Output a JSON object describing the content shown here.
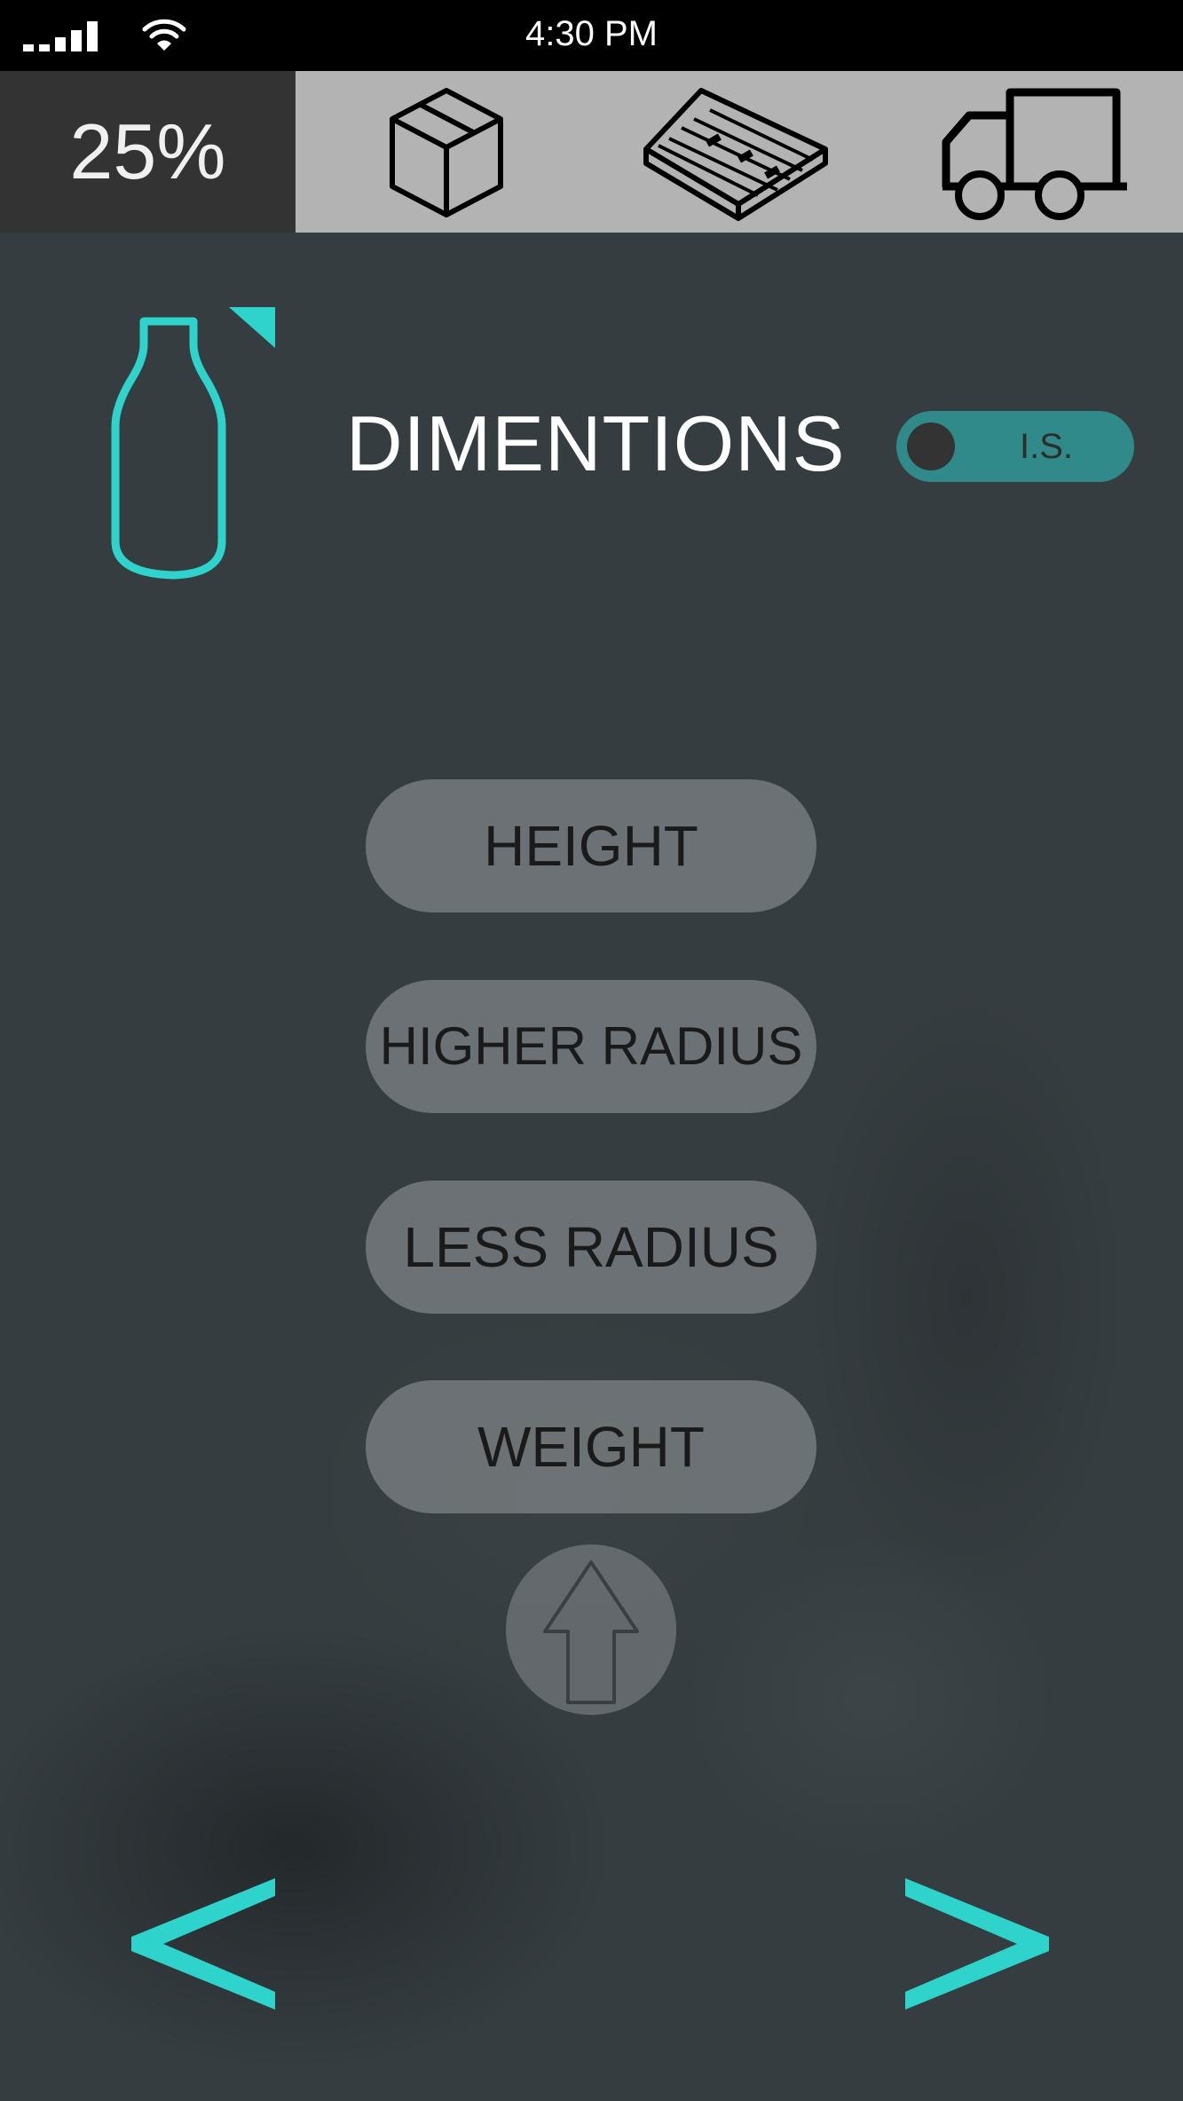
{
  "status_bar": {
    "time": "4:30 PM",
    "signal_icon": "signal-bars-icon",
    "wifi_icon": "wifi-icon"
  },
  "top_bar": {
    "progress": "25%",
    "steps": [
      {
        "icon": "box-icon"
      },
      {
        "icon": "pallet-icon"
      },
      {
        "icon": "truck-icon"
      }
    ]
  },
  "header": {
    "product_icon": "bottle-icon",
    "title": "DIMENTIONS",
    "toggle_label": "I.S."
  },
  "options": [
    {
      "label": "HEIGHT"
    },
    {
      "label": "HIGHER RADIUS"
    },
    {
      "label": "LESS RADIUS"
    },
    {
      "label": "WEIGHT"
    }
  ],
  "navigation": {
    "up_icon": "arrow-up-icon",
    "prev": "<",
    "next": ">"
  },
  "colors": {
    "accent": "#2ed4cb",
    "background": "#363d40",
    "toggle": "#2f8a89",
    "top_bar": "#b3b3b3",
    "progress_cell": "#333333"
  }
}
